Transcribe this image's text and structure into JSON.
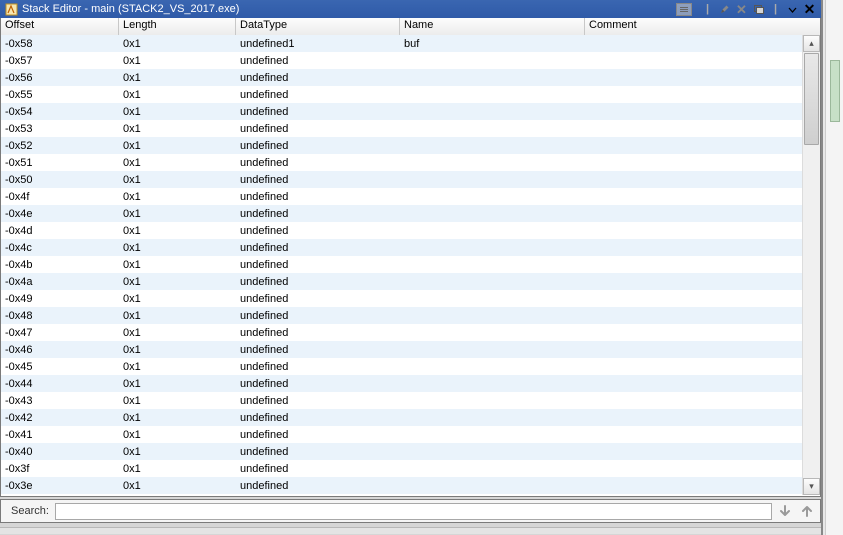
{
  "window": {
    "title": "Stack Editor - main (STACK2_VS_2017.exe)"
  },
  "columns": {
    "offset": "Offset",
    "length": "Length",
    "datatype": "DataType",
    "name": "Name",
    "comment": "Comment"
  },
  "rows": [
    {
      "offset": "-0x58",
      "length": "0x1",
      "datatype": "undefined1",
      "name": "buf",
      "comment": ""
    },
    {
      "offset": "-0x57",
      "length": "0x1",
      "datatype": "undefined",
      "name": "",
      "comment": ""
    },
    {
      "offset": "-0x56",
      "length": "0x1",
      "datatype": "undefined",
      "name": "",
      "comment": ""
    },
    {
      "offset": "-0x55",
      "length": "0x1",
      "datatype": "undefined",
      "name": "",
      "comment": ""
    },
    {
      "offset": "-0x54",
      "length": "0x1",
      "datatype": "undefined",
      "name": "",
      "comment": ""
    },
    {
      "offset": "-0x53",
      "length": "0x1",
      "datatype": "undefined",
      "name": "",
      "comment": ""
    },
    {
      "offset": "-0x52",
      "length": "0x1",
      "datatype": "undefined",
      "name": "",
      "comment": ""
    },
    {
      "offset": "-0x51",
      "length": "0x1",
      "datatype": "undefined",
      "name": "",
      "comment": ""
    },
    {
      "offset": "-0x50",
      "length": "0x1",
      "datatype": "undefined",
      "name": "",
      "comment": ""
    },
    {
      "offset": "-0x4f",
      "length": "0x1",
      "datatype": "undefined",
      "name": "",
      "comment": ""
    },
    {
      "offset": "-0x4e",
      "length": "0x1",
      "datatype": "undefined",
      "name": "",
      "comment": ""
    },
    {
      "offset": "-0x4d",
      "length": "0x1",
      "datatype": "undefined",
      "name": "",
      "comment": ""
    },
    {
      "offset": "-0x4c",
      "length": "0x1",
      "datatype": "undefined",
      "name": "",
      "comment": ""
    },
    {
      "offset": "-0x4b",
      "length": "0x1",
      "datatype": "undefined",
      "name": "",
      "comment": ""
    },
    {
      "offset": "-0x4a",
      "length": "0x1",
      "datatype": "undefined",
      "name": "",
      "comment": ""
    },
    {
      "offset": "-0x49",
      "length": "0x1",
      "datatype": "undefined",
      "name": "",
      "comment": ""
    },
    {
      "offset": "-0x48",
      "length": "0x1",
      "datatype": "undefined",
      "name": "",
      "comment": ""
    },
    {
      "offset": "-0x47",
      "length": "0x1",
      "datatype": "undefined",
      "name": "",
      "comment": ""
    },
    {
      "offset": "-0x46",
      "length": "0x1",
      "datatype": "undefined",
      "name": "",
      "comment": ""
    },
    {
      "offset": "-0x45",
      "length": "0x1",
      "datatype": "undefined",
      "name": "",
      "comment": ""
    },
    {
      "offset": "-0x44",
      "length": "0x1",
      "datatype": "undefined",
      "name": "",
      "comment": ""
    },
    {
      "offset": "-0x43",
      "length": "0x1",
      "datatype": "undefined",
      "name": "",
      "comment": ""
    },
    {
      "offset": "-0x42",
      "length": "0x1",
      "datatype": "undefined",
      "name": "",
      "comment": ""
    },
    {
      "offset": "-0x41",
      "length": "0x1",
      "datatype": "undefined",
      "name": "",
      "comment": ""
    },
    {
      "offset": "-0x40",
      "length": "0x1",
      "datatype": "undefined",
      "name": "",
      "comment": ""
    },
    {
      "offset": "-0x3f",
      "length": "0x1",
      "datatype": "undefined",
      "name": "",
      "comment": ""
    },
    {
      "offset": "-0x3e",
      "length": "0x1",
      "datatype": "undefined",
      "name": "",
      "comment": ""
    }
  ],
  "search": {
    "label": "Search:",
    "value": "",
    "placeholder": ""
  }
}
